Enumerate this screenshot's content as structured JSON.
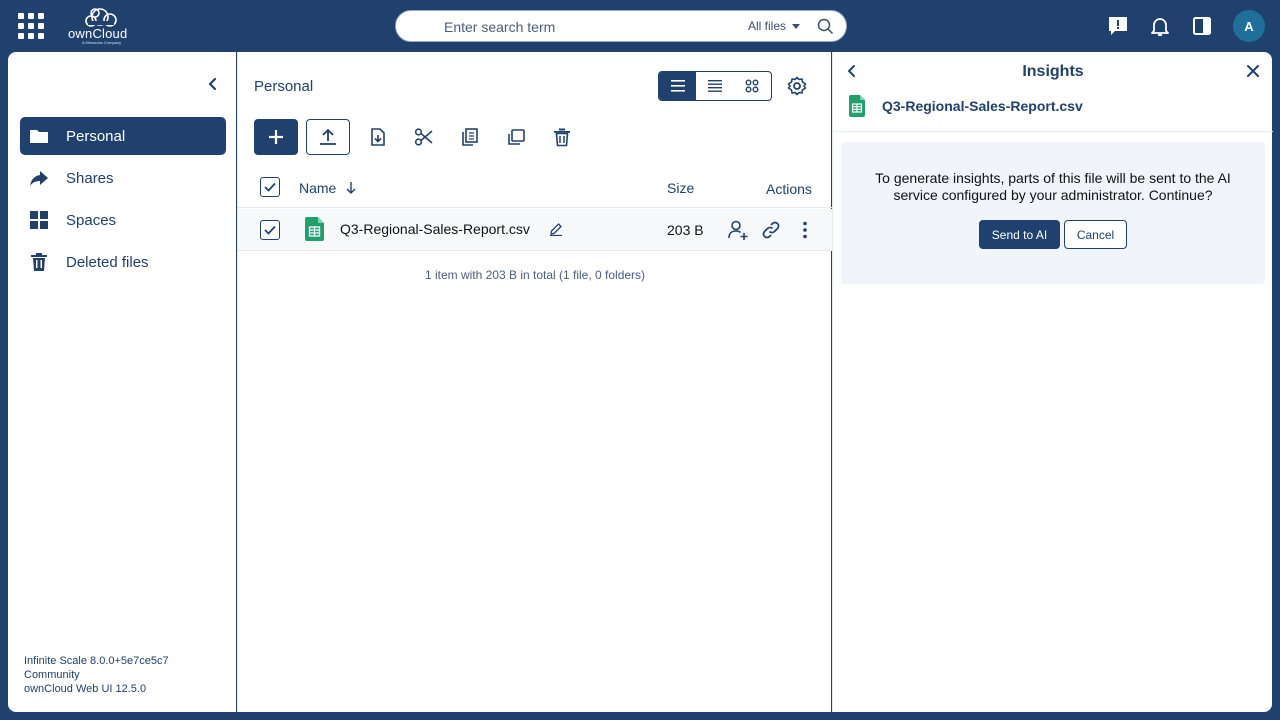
{
  "topbar": {
    "app_switcher_icon": "grid-icon",
    "logo_text": "ownCloud",
    "logo_subtext": "A Kiteworks Company",
    "search": {
      "placeholder": "Enter search term",
      "scope": "All files"
    },
    "icons": [
      "feedback-icon",
      "bell-icon",
      "sidebar-toggle-icon"
    ],
    "avatar_initial": "A"
  },
  "sidebar": {
    "items": [
      {
        "label": "Personal",
        "icon": "folder-icon",
        "active": true
      },
      {
        "label": "Shares",
        "icon": "share-icon",
        "active": false
      },
      {
        "label": "Spaces",
        "icon": "spaces-icon",
        "active": false
      },
      {
        "label": "Deleted files",
        "icon": "trash-icon",
        "active": false
      }
    ],
    "version": {
      "line1": "Infinite Scale 8.0.0+5e7ce5c7",
      "line2": "Community",
      "line3": "ownCloud Web UI 12.5.0"
    }
  },
  "main": {
    "breadcrumb": "Personal",
    "columns": {
      "name": "Name",
      "size": "Size",
      "actions": "Actions"
    },
    "files": [
      {
        "name": "Q3-Regional-Sales-Report.csv",
        "size": "203 B",
        "selected": true
      }
    ],
    "summary": "1 item with 203 B in total (1 file, 0 folders)"
  },
  "panel": {
    "title": "Insights",
    "file_name": "Q3-Regional-Sales-Report.csv",
    "consent_line1": "To generate insights, parts of this file will be sent to the AI",
    "consent_line2": "service configured by your administrator. Continue?",
    "send_label": "Send to AI",
    "cancel_label": "Cancel"
  },
  "colors": {
    "brand": "#20416e",
    "csv_green": "#21a06b",
    "consent_bg": "#f1f4fa"
  }
}
